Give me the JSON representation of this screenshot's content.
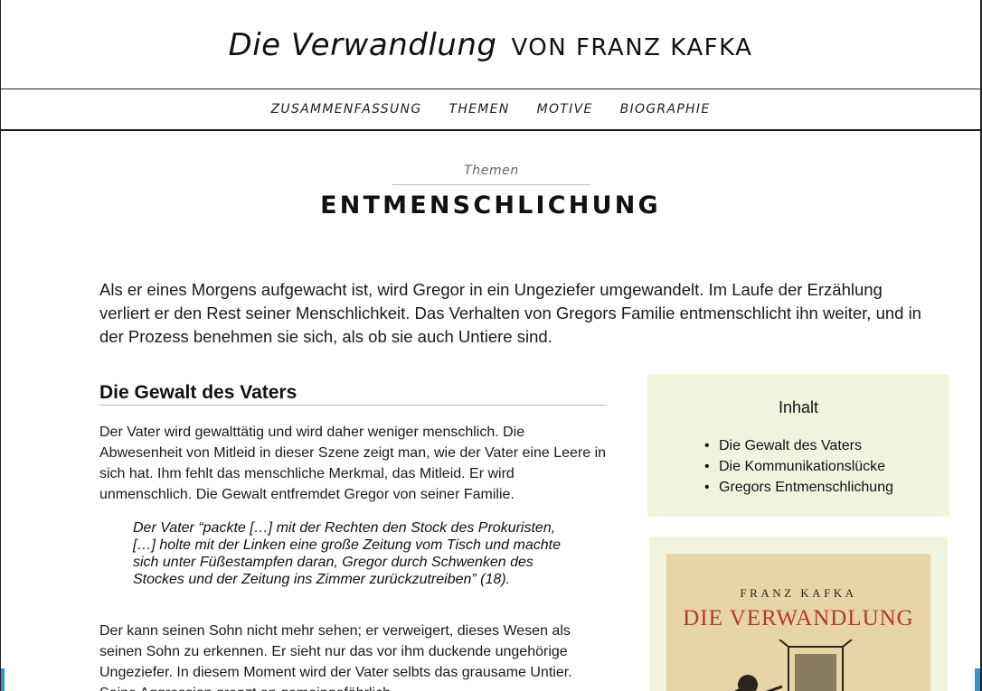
{
  "header": {
    "title_italic": "Die Verwandlung",
    "title_caps": "VON FRANZ KAFKA"
  },
  "nav": {
    "items": [
      {
        "label": "ZUSAMMENFASSUNG"
      },
      {
        "label": "THEMEN"
      },
      {
        "label": "MOTIVE"
      },
      {
        "label": "BIOGRAPHIE"
      }
    ]
  },
  "page": {
    "kicker": "Themen",
    "title": "ENTMENSCHLICHUNG",
    "intro": "Als er eines Morgens aufgewacht ist, wird Gregor in ein Ungeziefer umgewandelt. Im Laufe der Erzählung verliert er den Rest seiner Menschlichkeit. Das Verhalten von Gregors Familie entmenschlicht ihn weiter, und in der Prozess benehmen sie sich, als ob sie auch Untiere sind."
  },
  "section": {
    "title": "Die Gewalt des Vaters",
    "para1": "Der Vater wird gewalttätig und wird daher weniger menschlich. Die Abwesenheit von Mitleid in dieser Szene zeigt man, wie der Vater eine Leere in sich hat. Ihm fehlt das menschliche Merkmal, das Mitleid. Er wird unmenschlich. Die Gewalt entfremdet Gregor von seiner Familie.",
    "quote": "Der Vater “packte […] mit der Rechten den Stock des Prokuristen, […] holte mit der Linken eine große Zeitung vom Tisch und machte sich unter Füßestampfen daran, Gregor durch Schwenken des Stockes und der Zeitung ins Zimmer zurückzutreiben” (18).",
    "para2": "Der kann seinen Sohn nicht mehr sehen; er verweigert, dieses Wesen als seinen Sohn zu erkennen. Er sieht nur das vor ihm duckende ungehörige Ungeziefer. In diesem Moment wird der Vater selbts das grausame Untier. Seine Aggression grenzt an gemeingefährlich."
  },
  "toc": {
    "heading": "Inhalt",
    "items": [
      {
        "label": "Die Gewalt des Vaters"
      },
      {
        "label": "Die Kommunikationslücke"
      },
      {
        "label": "Gregors Entmenschlichung"
      }
    ]
  },
  "book": {
    "author": "FRANZ KAFKA",
    "title": "DIE VERWANDLUNG"
  },
  "colors": {
    "sidebar_bg": "#f1f4dd",
    "cover_bg": "#e7d4a8",
    "cover_title": "#b23a26"
  }
}
